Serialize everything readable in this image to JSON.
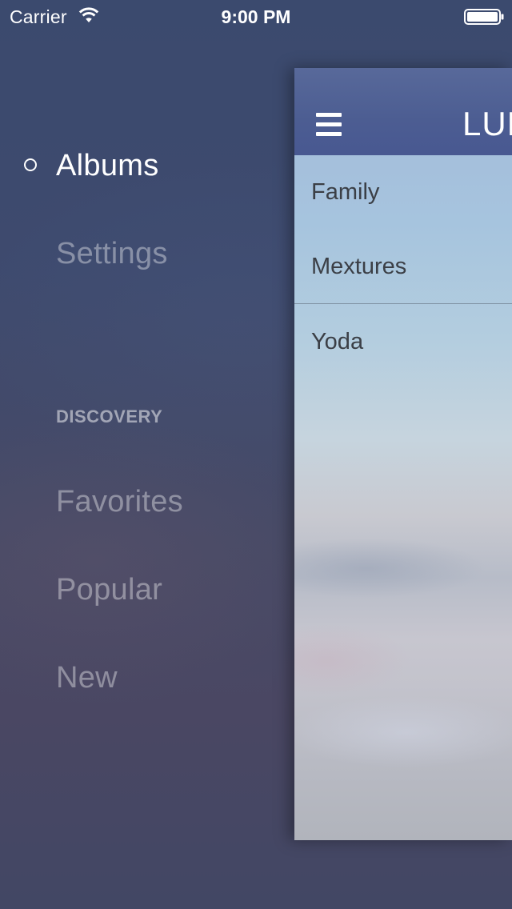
{
  "status_bar": {
    "carrier": "Carrier",
    "time": "9:00 PM",
    "icons": [
      "wifi-icon",
      "battery-icon"
    ]
  },
  "menu": {
    "items": [
      {
        "label": "Albums",
        "active": true
      },
      {
        "label": "Settings",
        "active": false
      }
    ],
    "section_header": "DISCOVERY",
    "section_items": [
      {
        "label": "Favorites"
      },
      {
        "label": "Popular"
      },
      {
        "label": "New"
      }
    ]
  },
  "panel": {
    "title": "LUMI",
    "menu_icon": "hamburger-icon",
    "rows": [
      {
        "label": "Family"
      },
      {
        "label": "Mextures"
      },
      {
        "label": "Yoda"
      }
    ]
  },
  "colors": {
    "background": "#3e4a6e",
    "nav_bar": "#4c5d92",
    "menu_inactive_text": "rgba(255,255,255,0.38)",
    "menu_active_text": "#ffffff",
    "row_text": "#3b3f46"
  }
}
